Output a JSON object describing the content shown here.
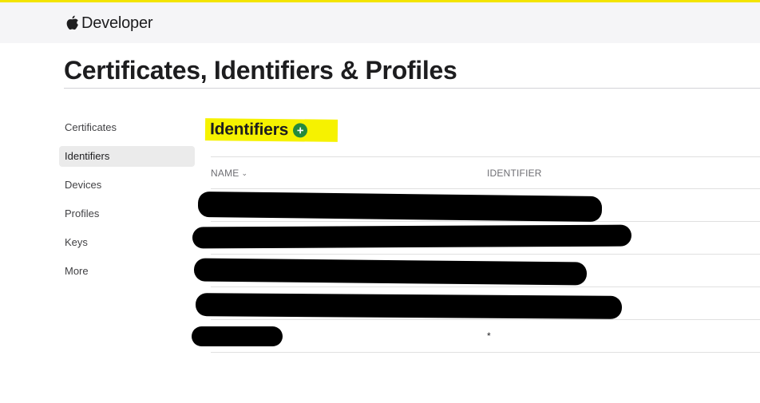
{
  "nav": {
    "brand": "Developer",
    "logo_icon": "apple-logo-icon"
  },
  "page": {
    "title": "Certificates, Identifiers & Profiles"
  },
  "sidebar": {
    "items": [
      {
        "label": "Certificates",
        "active": false
      },
      {
        "label": "Identifiers",
        "active": true
      },
      {
        "label": "Devices",
        "active": false
      },
      {
        "label": "Profiles",
        "active": false
      },
      {
        "label": "Keys",
        "active": false
      },
      {
        "label": "More",
        "active": false
      }
    ]
  },
  "section": {
    "title": "Identifiers",
    "add_icon": "add-circle-icon",
    "highlight_color": "#f6f200"
  },
  "table": {
    "columns": {
      "name": "NAME",
      "identifier": "IDENTIFIER"
    },
    "sort_icon": "chevron-down-icon",
    "rows": [
      {
        "name": "",
        "identifier": "",
        "redacted": true
      },
      {
        "name": "",
        "identifier": "",
        "redacted": true
      },
      {
        "name": "",
        "identifier": "",
        "redacted": true
      },
      {
        "name": "",
        "identifier": "",
        "redacted": true
      },
      {
        "name": "",
        "identifier": "*",
        "redacted": true
      }
    ]
  },
  "colors": {
    "accent_bar": "#f3e400",
    "add_button": "#248a3d",
    "nav_background": "#f5f5f7"
  }
}
